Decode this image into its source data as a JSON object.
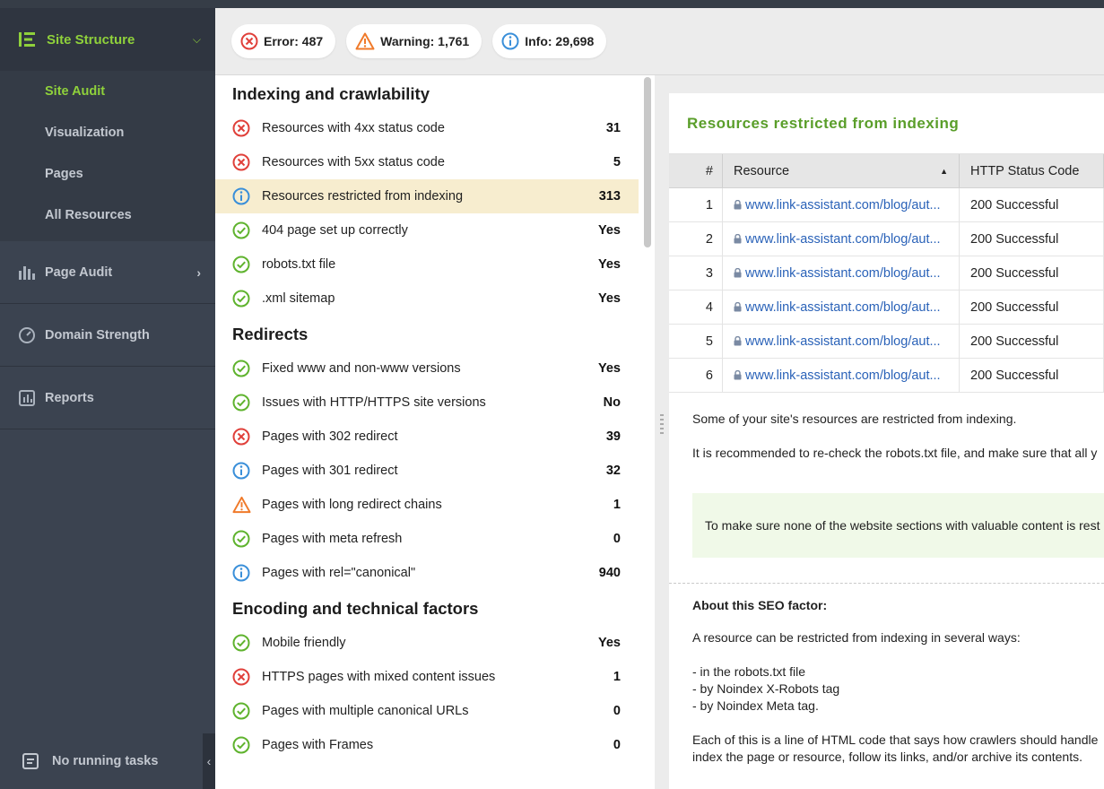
{
  "sidebar": {
    "header": {
      "label": "Site Structure",
      "icon": "site-structure-icon"
    },
    "sub_items": [
      {
        "label": "Site Audit",
        "active": true
      },
      {
        "label": "Visualization",
        "active": false
      },
      {
        "label": "Pages",
        "active": false
      },
      {
        "label": "All Resources",
        "active": false
      }
    ],
    "sections": [
      {
        "label": "Page Audit",
        "icon": "page-audit-icon"
      },
      {
        "label": "Domain Strength",
        "icon": "gauge-icon"
      },
      {
        "label": "Reports",
        "icon": "reports-icon"
      }
    ],
    "tasks": "No running tasks"
  },
  "status": {
    "error": "Error: 487",
    "warning": "Warning: 1,761",
    "info": "Info: 29,698"
  },
  "groups": [
    {
      "title": "Indexing and crawlability",
      "rows": [
        {
          "status": "error",
          "label": "Resources with 4xx status code",
          "value": "31"
        },
        {
          "status": "error",
          "label": "Resources with 5xx status code",
          "value": "5"
        },
        {
          "status": "info",
          "label": "Resources restricted from indexing",
          "value": "313",
          "selected": true
        },
        {
          "status": "ok",
          "label": "404 page set up correctly",
          "value": "Yes"
        },
        {
          "status": "ok",
          "label": "robots.txt file",
          "value": "Yes"
        },
        {
          "status": "ok",
          "label": ".xml sitemap",
          "value": "Yes"
        }
      ]
    },
    {
      "title": "Redirects",
      "rows": [
        {
          "status": "ok",
          "label": "Fixed www and non-www versions",
          "value": "Yes"
        },
        {
          "status": "ok",
          "label": "Issues with HTTP/HTTPS site versions",
          "value": "No"
        },
        {
          "status": "error",
          "label": "Pages with 302 redirect",
          "value": "39"
        },
        {
          "status": "info",
          "label": "Pages with 301 redirect",
          "value": "32"
        },
        {
          "status": "warning",
          "label": "Pages with long redirect chains",
          "value": "1"
        },
        {
          "status": "ok",
          "label": "Pages with meta refresh",
          "value": "0"
        },
        {
          "status": "info",
          "label": "Pages with rel=\"canonical\"",
          "value": "940"
        }
      ]
    },
    {
      "title": "Encoding and technical factors",
      "rows": [
        {
          "status": "ok",
          "label": "Mobile friendly",
          "value": "Yes"
        },
        {
          "status": "error",
          "label": "HTTPS pages with mixed content issues",
          "value": "1"
        },
        {
          "status": "ok",
          "label": "Pages with multiple canonical URLs",
          "value": "0"
        },
        {
          "status": "ok",
          "label": "Pages with Frames",
          "value": "0"
        }
      ]
    }
  ],
  "detail": {
    "title": "Resources restricted from indexing",
    "columns": [
      "#",
      "Resource",
      "HTTP Status Code"
    ],
    "rows": [
      {
        "n": "1",
        "resource": "www.link-assistant.com/blog/aut...",
        "code": "200 Successful"
      },
      {
        "n": "2",
        "resource": "www.link-assistant.com/blog/aut...",
        "code": "200 Successful"
      },
      {
        "n": "3",
        "resource": "www.link-assistant.com/blog/aut...",
        "code": "200 Successful"
      },
      {
        "n": "4",
        "resource": "www.link-assistant.com/blog/aut...",
        "code": "200 Successful"
      },
      {
        "n": "5",
        "resource": "www.link-assistant.com/blog/aut...",
        "code": "200 Successful"
      },
      {
        "n": "6",
        "resource": "www.link-assistant.com/blog/aut...",
        "code": "200 Successful"
      }
    ],
    "description": {
      "line1": "Some of your site's resources are restricted from indexing.",
      "line2": "It is recommended to re-check the robots.txt file, and make sure that all y",
      "tip": "To make sure none of the website sections with valuable content is rest",
      "about_title": "About this SEO factor:",
      "about1": "A resource can be restricted from indexing in several ways:",
      "bullet1": "- in the robots.txt file",
      "bullet2": "- by Noindex X-Robots tag",
      "bullet3": "- by Noindex Meta tag.",
      "about2": "Each of this is a line of HTML code that says how crawlers should handle",
      "about3": "index the page or resource, follow its links, and/or archive its contents."
    }
  },
  "colors": {
    "accent": "#8fd13b",
    "error": "#e0403a",
    "warning": "#f07a2a",
    "info": "#3a8fd9",
    "ok": "#5fb32e",
    "link": "#2a62b8"
  }
}
